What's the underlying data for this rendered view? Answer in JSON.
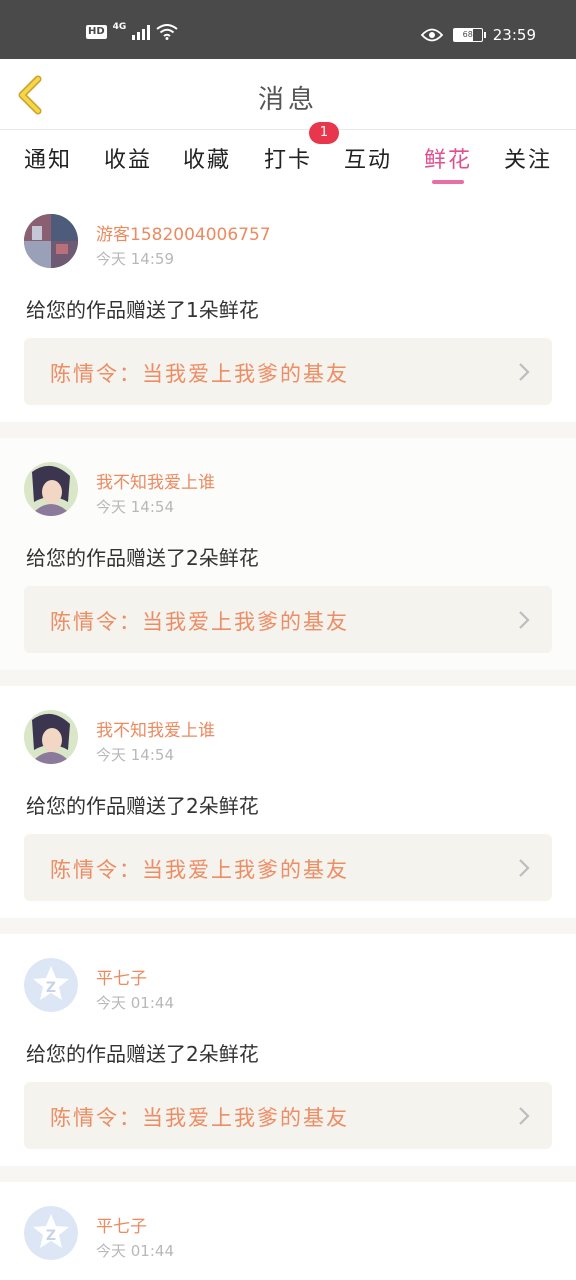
{
  "status_bar": {
    "hd": "HD",
    "network": "4G",
    "battery": "68",
    "time": "23:59"
  },
  "header": {
    "title": "消息",
    "back_icon": "chevron-left-icon"
  },
  "tabs": [
    {
      "label": "通知"
    },
    {
      "label": "收益"
    },
    {
      "label": "收藏"
    },
    {
      "label": "打卡"
    },
    {
      "label": "互动"
    },
    {
      "label": "鲜花",
      "active": true
    },
    {
      "label": "关注"
    }
  ],
  "tab_badge": "1",
  "colors": {
    "accent_pink": "#e0508f",
    "username_orange": "#ec8a60",
    "badge_red": "#e8374c",
    "status_bar": "#4a4a4a"
  },
  "messages": [
    {
      "username": "游客1582004006757",
      "time": "今天 14:59",
      "content": "给您的作品赠送了1朵鲜花",
      "work_title": "陈情令：当我爱上我爹的基友"
    },
    {
      "username": "我不知我爱上谁",
      "time": "今天 14:54",
      "content": "给您的作品赠送了2朵鲜花",
      "work_title": "陈情令：当我爱上我爹的基友"
    },
    {
      "username": "我不知我爱上谁",
      "time": "今天 14:54",
      "content": "给您的作品赠送了2朵鲜花",
      "work_title": "陈情令：当我爱上我爹的基友"
    },
    {
      "username": "平七子",
      "time": "今天 01:44",
      "content": "给您的作品赠送了2朵鲜花",
      "work_title": "陈情令：当我爱上我爹的基友"
    },
    {
      "username": "平七子",
      "time": "今天 01:44",
      "content": "",
      "work_title": ""
    }
  ]
}
